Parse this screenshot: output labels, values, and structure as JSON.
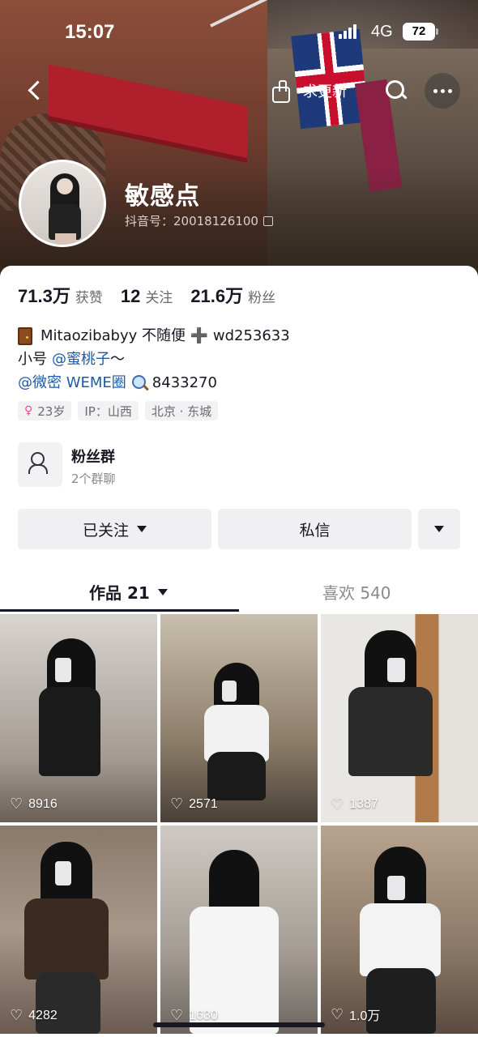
{
  "status_bar": {
    "time": "15:07",
    "network": "4G",
    "battery": "72"
  },
  "nav": {
    "ask_update_label": "求更新"
  },
  "profile": {
    "nickname": "敏感点",
    "douyin_id": "抖音号：20018126100"
  },
  "stats": [
    {
      "value": "71.3万",
      "label": "获赞"
    },
    {
      "value": "12",
      "label": "关注"
    },
    {
      "value": "21.6万",
      "label": "粉丝"
    }
  ],
  "bio": {
    "line1": "Mitaozibabyy 不随便 ➕ wd253633",
    "line2_prefix": "小号",
    "line2_mention": "@蜜桃子",
    "line2_suffix": " ～",
    "line3_mention": "@微密 WEME圈",
    "line3_suffix": "8433270"
  },
  "tags": {
    "age": "23岁",
    "ip": "IP：山西",
    "location": "北京 · 东城"
  },
  "fan_group": {
    "title": "粉丝群",
    "subtitle": "2个群聊"
  },
  "actions": {
    "follow": "已关注",
    "message": "私信"
  },
  "tabs": {
    "works": "作品 21",
    "likes": "喜欢 540"
  },
  "videos": [
    {
      "likes": "8916"
    },
    {
      "likes": "2571"
    },
    {
      "likes": "1387"
    },
    {
      "likes": "4282"
    },
    {
      "likes": "1630"
    },
    {
      "likes": "1.0万"
    }
  ],
  "colors": {
    "accent_link": "#1e5aa8",
    "text_primary": "#161823",
    "text_secondary": "#6b6b6b"
  }
}
